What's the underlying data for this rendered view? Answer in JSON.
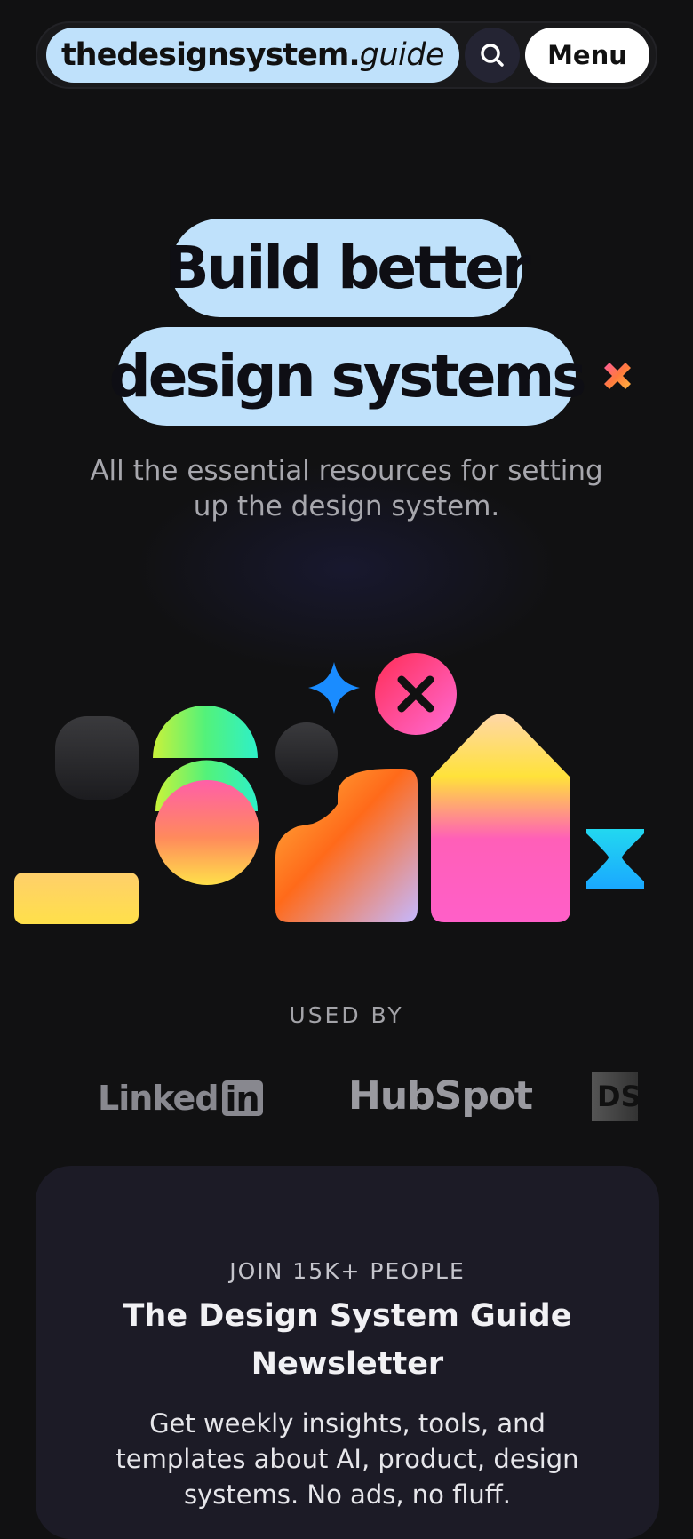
{
  "nav": {
    "logo_main": "thedesignsystem.",
    "logo_italic": "guide",
    "search_icon": "search-icon",
    "menu_label": "Menu"
  },
  "hero": {
    "line1": "Build better",
    "line2": "design systems",
    "subtitle": "All the essential resources for setting up the design system."
  },
  "used_by": {
    "label": "USED BY",
    "logos": [
      "LinkedIn",
      "HubSpot",
      "DS"
    ],
    "linkedin_text": "Linked",
    "linkedin_box": "in",
    "hubspot_text": "HubSpot",
    "ds_text": "DS"
  },
  "newsletter": {
    "eyebrow": "JOIN 15K+ PEOPLE",
    "title": "The Design System Guide Newsletter",
    "description": "Get weekly insights, tools, and templates about AI, product, design systems. No ads, no fluff."
  },
  "colors": {
    "accent": "#bfe1fb",
    "background": "#111112",
    "card": "#1c1b26"
  }
}
